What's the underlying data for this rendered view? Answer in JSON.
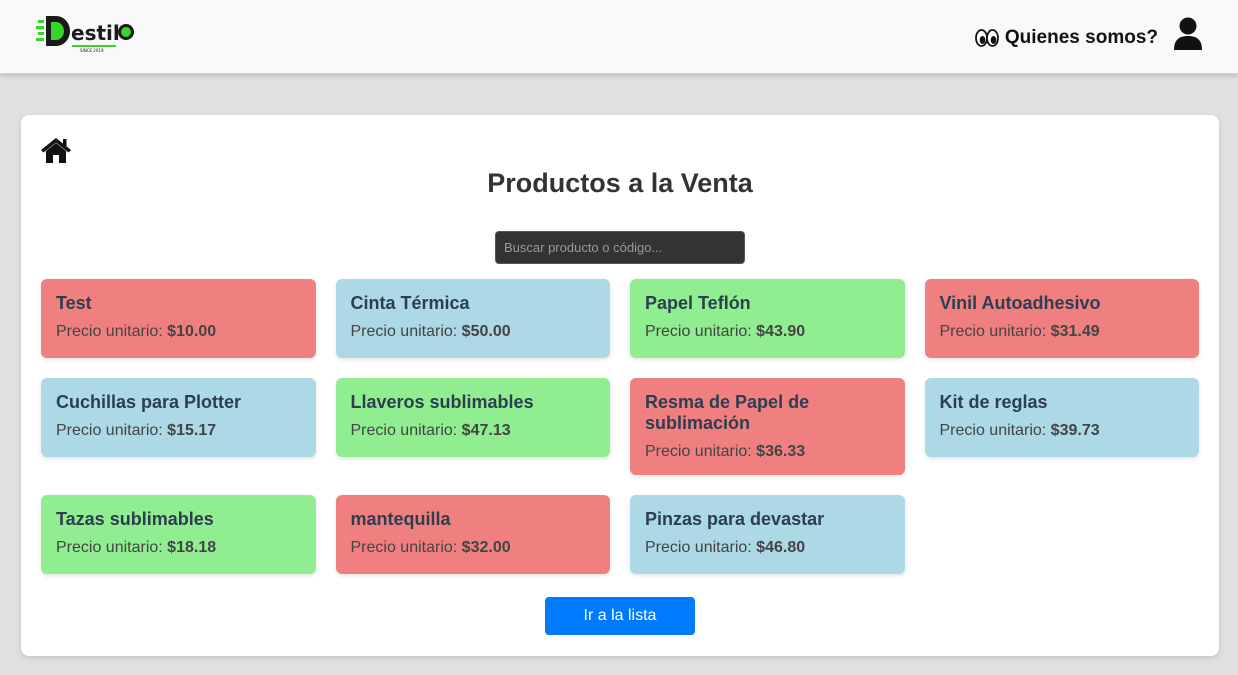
{
  "header": {
    "logo_text": "D'estilo",
    "logo_tagline": "SINCE 2019",
    "about_label": "Quienes somos?"
  },
  "main": {
    "title": "Productos a la Venta",
    "search_placeholder": "Buscar producto o código...",
    "price_label": "Precio unitario:",
    "products": [
      {
        "name": "Test",
        "price": "$10.00",
        "color": "red"
      },
      {
        "name": "Cinta Térmica",
        "price": "$50.00",
        "color": "blue"
      },
      {
        "name": "Papel Teflón",
        "price": "$43.90",
        "color": "green"
      },
      {
        "name": "Vinil Autoadhesivo",
        "price": "$31.49",
        "color": "red"
      },
      {
        "name": "Cuchillas para Plotter",
        "price": "$15.17",
        "color": "blue"
      },
      {
        "name": "Llaveros sublimables",
        "price": "$47.13",
        "color": "green"
      },
      {
        "name": "Resma de Papel de sublimación",
        "price": "$36.33",
        "color": "red"
      },
      {
        "name": "Kit de reglas",
        "price": "$39.73",
        "color": "blue"
      },
      {
        "name": "Tazas sublimables",
        "price": "$18.18",
        "color": "green"
      },
      {
        "name": "mantequilla",
        "price": "$32.00",
        "color": "red"
      },
      {
        "name": "Pinzas para devastar",
        "price": "$46.80",
        "color": "blue"
      }
    ],
    "list_button_label": "Ir a la lista"
  },
  "colors": {
    "red": "#f08080",
    "blue": "#add8e6",
    "green": "#90ee90",
    "button": "#007bff",
    "logo_green": "#39d42a"
  },
  "icons": {
    "about": "eyes-icon",
    "user": "user-icon",
    "home": "home-icon"
  }
}
